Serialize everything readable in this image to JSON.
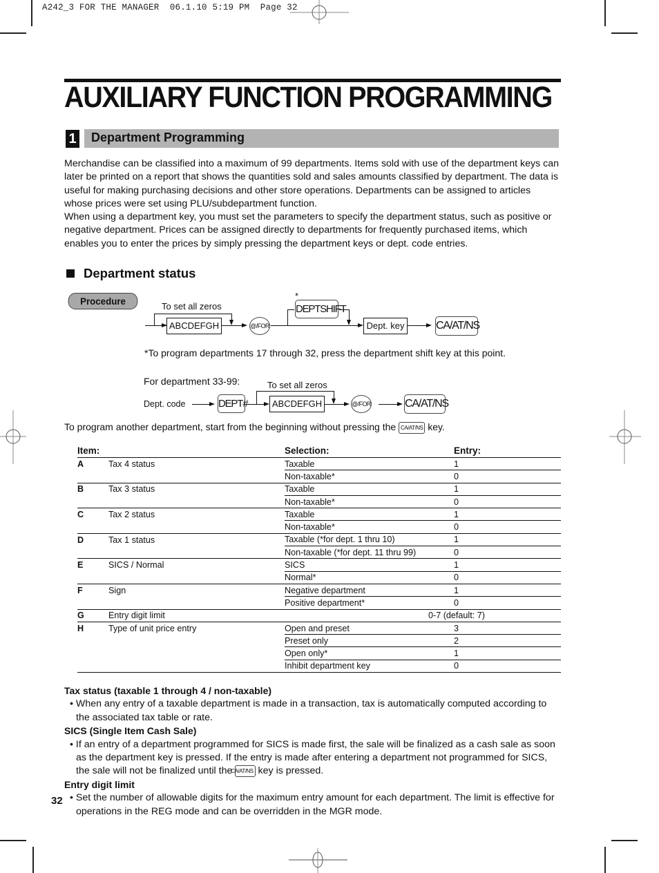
{
  "slug": "A242_3 FOR THE MANAGER  06.1.10 5:19 PM  Page 32",
  "page_title": "AUXILIARY FUNCTION PROGRAMMING",
  "section": {
    "number": "1",
    "title": "Department Programming"
  },
  "intro_paragraphs": [
    "Merchandise can be classified into a maximum of 99 departments.  Items sold with use of the department keys can later be printed on a report that shows the quantities sold and sales amounts classified by department.  The data is useful for making purchasing decisions and other store operations.  Departments can be assigned to articles whose prices were set using PLU/subdepartment function.",
    "When using a department key, you must set the parameters to specify the department status, such as positive or negative department.  Prices can be assigned directly to departments for frequently purchased items, which enables you to enter the prices by simply pressing the department keys or dept. code entries."
  ],
  "subsection_title": "Department status",
  "procedure_label": "Procedure",
  "diagram1": {
    "zeros_label": "To set all zeros",
    "entry_box": "ABCDEFGH",
    "for_key": "@/FOR",
    "asterisk": "*",
    "shift_key": "DEPTSHIFT",
    "dept_key_box": "Dept. key",
    "end_key": "CA/AT/NS"
  },
  "footnote": "*To program departments 17 through 32, press the department shift key at this point.",
  "diagram2": {
    "heading": "For department 33-99:",
    "start_label": "Dept. code",
    "dept_key": "DEPT#",
    "zeros_label": "To set all zeros",
    "entry_box": "ABCDEFGH",
    "for_key": "@/FOR",
    "end_key": "CA/AT/NS"
  },
  "another_dept": {
    "before": "To program another department, start from the beginning without pressing the ",
    "key": "CA/AT/NS",
    "after": " key."
  },
  "table": {
    "headers": {
      "item": "Item:",
      "selection": "Selection:",
      "entry": "Entry:"
    },
    "rows": [
      {
        "letter": "A",
        "item": "Tax 4 status",
        "options": [
          {
            "sel": "Taxable",
            "entry": "1"
          },
          {
            "sel": "Non-taxable*",
            "entry": "0"
          }
        ]
      },
      {
        "letter": "B",
        "item": "Tax 3 status",
        "options": [
          {
            "sel": "Taxable",
            "entry": "1"
          },
          {
            "sel": "Non-taxable*",
            "entry": "0"
          }
        ]
      },
      {
        "letter": "C",
        "item": "Tax 2 status",
        "options": [
          {
            "sel": "Taxable",
            "entry": "1"
          },
          {
            "sel": "Non-taxable*",
            "entry": "0"
          }
        ]
      },
      {
        "letter": "D",
        "item": "Tax 1 status",
        "options": [
          {
            "sel": "Taxable (*for dept. 1 thru 10)",
            "entry": "1"
          },
          {
            "sel": "Non-taxable (*for dept. 11 thru 99)",
            "entry": "0"
          }
        ]
      },
      {
        "letter": "E",
        "item": "SICS / Normal",
        "options": [
          {
            "sel": "SICS",
            "entry": "1"
          },
          {
            "sel": "Normal*",
            "entry": "0"
          }
        ]
      },
      {
        "letter": "F",
        "item": "Sign",
        "options": [
          {
            "sel": "Negative department",
            "entry": "1"
          },
          {
            "sel": "Positive department*",
            "entry": "0"
          }
        ]
      },
      {
        "letter": "G",
        "item": "Entry digit limit",
        "range": "0-7 (default: 7)"
      },
      {
        "letter": "H",
        "item": "Type of unit price entry",
        "options": [
          {
            "sel": "Open and preset",
            "entry": "3"
          },
          {
            "sel": "Preset only",
            "entry": "2"
          },
          {
            "sel": "Open only*",
            "entry": "1"
          },
          {
            "sel": "Inhibit department key",
            "entry": "0"
          }
        ]
      }
    ]
  },
  "notes": [
    {
      "heading": "Tax status (taxable 1 through 4 / non-taxable)",
      "bullet": "When any entry of a taxable department is made in a transaction, tax is automatically computed according to the associated tax table or rate."
    },
    {
      "heading": "SICS (Single Item Cash Sale)",
      "bullet_before": "If an entry of a department programmed for SICS is made first, the sale will be finalized as a cash sale as soon as the department key is pressed.  If the entry is made after entering a department not programmed for SICS, the sale will not be finalized until the ",
      "bullet_key": "CA/AT/NS",
      "bullet_after": " key is pressed."
    },
    {
      "heading": "Entry digit limit",
      "bullet": "Set the number of allowable digits for the maximum entry amount for each department.  The limit is effective for operations in the REG mode and can be overridden in the MGR mode."
    }
  ],
  "page_number": "32",
  "colors": {
    "section_bar": "#b3b3b3",
    "procedure_pill": "#a8a8a8",
    "text": "#111111"
  }
}
